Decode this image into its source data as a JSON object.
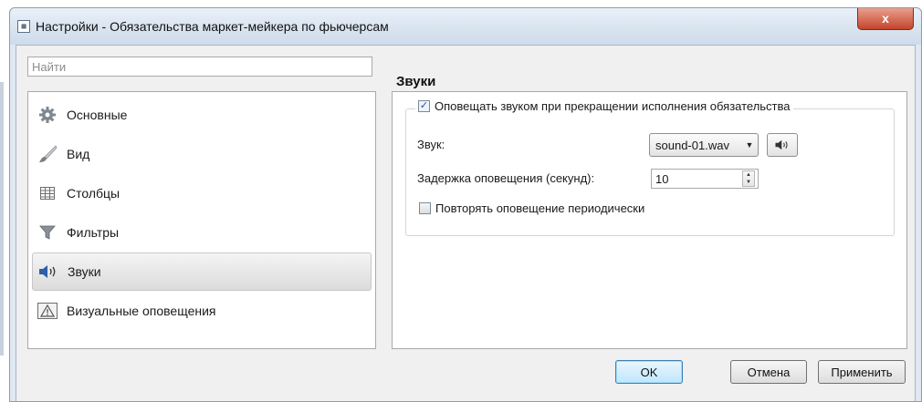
{
  "window": {
    "title": "Настройки - Обязательства маркет-мейкера по фьючерсам",
    "close_label": "x"
  },
  "search": {
    "placeholder": "Найти"
  },
  "sidebar": {
    "items": [
      {
        "label": "Основные",
        "icon": "gear-icon",
        "selected": false
      },
      {
        "label": "Вид",
        "icon": "brush-icon",
        "selected": false
      },
      {
        "label": "Столбцы",
        "icon": "table-icon",
        "selected": false
      },
      {
        "label": "Фильтры",
        "icon": "funnel-icon",
        "selected": false
      },
      {
        "label": "Звуки",
        "icon": "speaker-icon",
        "selected": true
      },
      {
        "label": "Визуальные оповещения",
        "icon": "warning-icon",
        "selected": false
      }
    ]
  },
  "section": {
    "title": "Звуки",
    "notify_label": "Оповещать звуком при прекращении исполнения обязательства",
    "notify_checked": true,
    "sound_label": "Звук:",
    "sound_value": "sound-01.wav",
    "delay_label": "Задержка оповещения (секунд):",
    "delay_value": "10",
    "repeat_label": "Повторять оповещение периодически",
    "repeat_checked": false
  },
  "buttons": {
    "ok": "OK",
    "cancel": "Отмена",
    "apply": "Применить"
  },
  "colors": {
    "default_button": "#bee6fd",
    "close_button": "#c4442a",
    "checkbox_mark": "#2050a0"
  }
}
